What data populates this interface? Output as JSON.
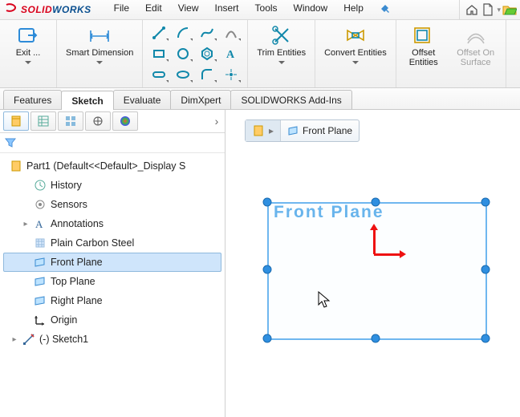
{
  "menu": {
    "items": [
      "File",
      "Edit",
      "View",
      "Insert",
      "Tools",
      "Window",
      "Help"
    ]
  },
  "ribbon": {
    "exit": "Exit ...",
    "smartdim": "Smart Dimension",
    "trim": "Trim Entities",
    "convert": "Convert Entities",
    "offset": "Offset Entities",
    "offsetSurf": "Offset On Surface"
  },
  "tabs": [
    "Features",
    "Sketch",
    "Evaluate",
    "DimXpert",
    "SOLIDWORKS Add-Ins"
  ],
  "active_tab": "Sketch",
  "tree": {
    "root": "Part1  (Default<<Default>_Display S",
    "items": [
      {
        "label": "History",
        "icon": "history"
      },
      {
        "label": "Sensors",
        "icon": "sensors"
      },
      {
        "label": "Annotations",
        "icon": "annotations",
        "expandable": true
      },
      {
        "label": "Plain Carbon Steel",
        "icon": "material"
      },
      {
        "label": "Front Plane",
        "icon": "plane",
        "selected": true
      },
      {
        "label": "Top Plane",
        "icon": "plane"
      },
      {
        "label": "Right Plane",
        "icon": "plane"
      },
      {
        "label": "Origin",
        "icon": "origin"
      },
      {
        "label": "(-) Sketch1",
        "icon": "sketch",
        "expandable": true,
        "level": "b"
      }
    ]
  },
  "chip": {
    "label": "Front Plane"
  },
  "plane_overlay": "Front Plane"
}
